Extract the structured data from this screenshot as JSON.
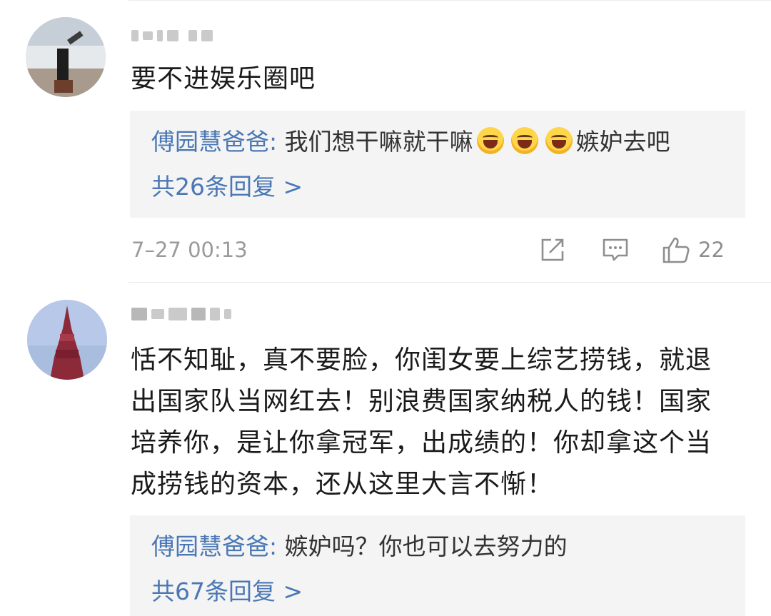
{
  "comments": [
    {
      "body": "要不进娱乐圈吧",
      "reply": {
        "author": "傅园慧爸爸:",
        "text_before": "我们想干嘛就干嘛",
        "emojis": [
          "laughing-face-emoji",
          "laughing-face-emoji",
          "laughing-face-emoji"
        ],
        "text_after": "嫉妒去吧",
        "count_label": "共26条回复 >"
      },
      "timestamp": "7–27 00:13",
      "likes": "22"
    },
    {
      "body_lines": [
        "恬不知耻，真不要脸，你闺女要上综艺捞钱，就退",
        "出国家队当网红去！别浪费国家纳税人的钱！国家",
        "培养你，是让你拿冠军，出成绩的！你却拿这个当",
        "成捞钱的资本，还从这里大言不惭！"
      ],
      "reply": {
        "author": "傅园慧爸爸:",
        "text": "嫉妒吗？你也可以去努力的",
        "count_label": "共67条回复 >"
      }
    }
  ],
  "icons": {
    "share": "share-icon",
    "comment": "comment-icon",
    "like": "thumbs-up-icon"
  },
  "colors": {
    "link": "#4b78b5",
    "meta": "#9a9a9a",
    "reply_bg": "#f4f4f4"
  }
}
